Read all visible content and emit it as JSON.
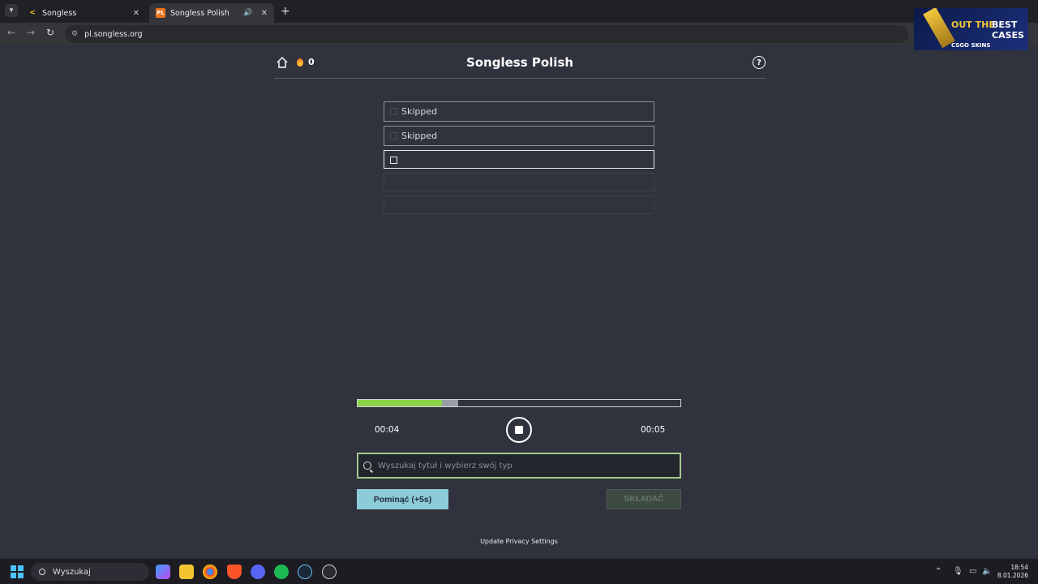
{
  "browser": {
    "tabs": [
      {
        "title": "Songless",
        "active": false
      },
      {
        "title": "Songless Polish",
        "active": true
      }
    ],
    "url": "pl.songless.org"
  },
  "ad": {
    "word1": "OUT THE",
    "word2": "BEST CASES",
    "brand": "CSGO SKINS"
  },
  "header": {
    "title": "Songless Polish",
    "streak": "0"
  },
  "guesses": [
    {
      "text": "Skipped",
      "state": "skipped"
    },
    {
      "text": "Skipped",
      "state": "skipped"
    },
    {
      "text": "",
      "state": "current"
    },
    {
      "text": "",
      "state": "empty"
    },
    {
      "text": "",
      "state": "empty"
    }
  ],
  "player": {
    "current_time": "00:04",
    "total_time": "00:05",
    "played_fraction": 0.262,
    "buffered_fraction": 0.312
  },
  "search": {
    "placeholder": "Wyszukaj tytuł i wybierz swój typ"
  },
  "buttons": {
    "skip": "Pominąć (+5s)",
    "submit": "SKŁADAĆ"
  },
  "footer": {
    "privacy": "Update Privacy Settings"
  },
  "taskbar": {
    "search_label": "Wyszukaj",
    "time": "18:54",
    "date": "8.01.2026"
  },
  "colors": {
    "progress_played": "#8bd44a",
    "skip_button": "#8ccbd8",
    "search_border": "#a3c98c"
  }
}
